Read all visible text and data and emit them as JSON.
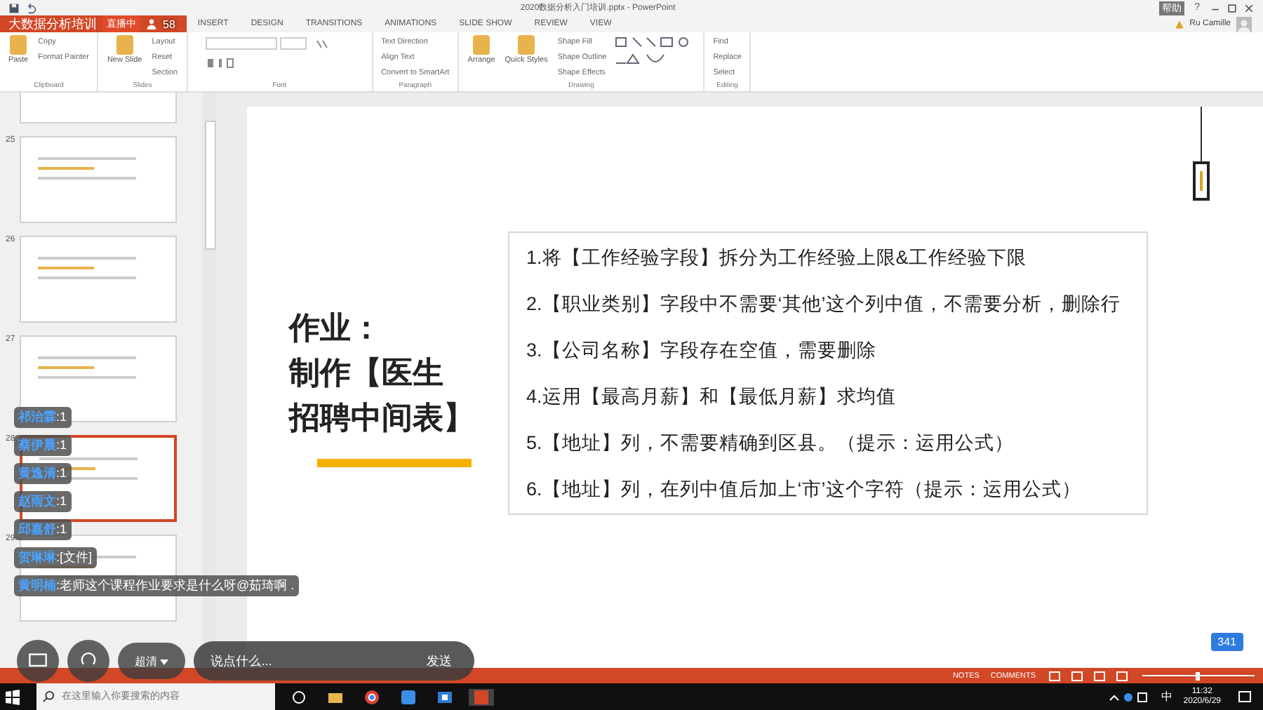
{
  "window": {
    "title": "2020数据分析入门培训.pptx - PowerPoint",
    "help_glyph": "?"
  },
  "live": {
    "title": "大数据分析培训",
    "status": "直播中",
    "viewers": "58",
    "help": "帮助"
  },
  "tabs": [
    {
      "label": "INSERT",
      "selected": false
    },
    {
      "label": "DESIGN",
      "selected": false
    },
    {
      "label": "TRANSITIONS",
      "selected": false
    },
    {
      "label": "ANIMATIONS",
      "selected": false
    },
    {
      "label": "SLIDE SHOW",
      "selected": false
    },
    {
      "label": "REVIEW",
      "selected": false
    },
    {
      "label": "VIEW",
      "selected": false
    }
  ],
  "account": {
    "user": "Ru Camille"
  },
  "ribbon": [
    {
      "name": "Clipboard",
      "large": [
        "Paste"
      ],
      "small": [
        "Copy",
        "Format Painter"
      ]
    },
    {
      "name": "Slides",
      "large": [
        "New Slide"
      ],
      "small": [
        "Layout",
        "Reset",
        "Section"
      ]
    },
    {
      "name": "Font"
    },
    {
      "name": "Paragraph",
      "small": [
        "Text Direction",
        "Align Text",
        "Convert to SmartArt"
      ]
    },
    {
      "name": "Drawing",
      "large": [
        "Arrange",
        "Quick Styles"
      ],
      "small": [
        "Shape Fill",
        "Shape Outline",
        "Shape Effects"
      ]
    },
    {
      "name": "Editing",
      "small": [
        "Find",
        "Replace",
        "Select"
      ]
    }
  ],
  "thumbnails": [
    {
      "selected": false
    },
    {
      "number": "25",
      "selected": false
    },
    {
      "number": "26",
      "selected": false
    },
    {
      "number": "27",
      "selected": false
    },
    {
      "number": "28",
      "selected": true
    },
    {
      "number": "29",
      "selected": false
    }
  ],
  "chat": [
    {
      "user": "祁治霖",
      "message": ":1"
    },
    {
      "user": "蔡伊晨",
      "message": ":1"
    },
    {
      "user": "黄逸清",
      "message": ":1"
    },
    {
      "user": "赵雨文",
      "message": ":1"
    },
    {
      "user": "邱嘉舒",
      "message": ":1"
    },
    {
      "user": "贺琳琳",
      "message": ":[文件]"
    },
    {
      "user": "黄明楠",
      "message": ":老师这个课程作业要求是什么呀@茹琦啊 ."
    }
  ],
  "slide": {
    "title_lines": [
      "作业：",
      "制作【医生",
      "招聘中间表】"
    ],
    "tasks": [
      "1.将【工作经验字段】拆分为工作经验上限&工作经验下限",
      "2.【职业类别】字段中不需要‘其他’这个列中值，不需要分析，删除行",
      "3.【公司名称】字段存在空值，需要删除",
      "4.运用【最高月薪】和【最低月薪】求均值",
      "5.【地址】列，不需要精确到区县。（提示：运用公式）",
      "6.【地址】列，在列中值后加上‘市’这个字符（提示：运用公式）"
    ]
  },
  "live_bar": {
    "quality": "超清",
    "placeholder": "说点什么...",
    "send": "发送",
    "counter": "341"
  },
  "status_bar": {
    "notes": "NOTES",
    "comments": "COMMENTS",
    "zoom": {
      "level": 0.5
    }
  },
  "taskbar": {
    "search_placeholder": "在这里输入你要搜索的内容",
    "ime": "中",
    "time": "11:32",
    "date": "2020/6/29"
  }
}
